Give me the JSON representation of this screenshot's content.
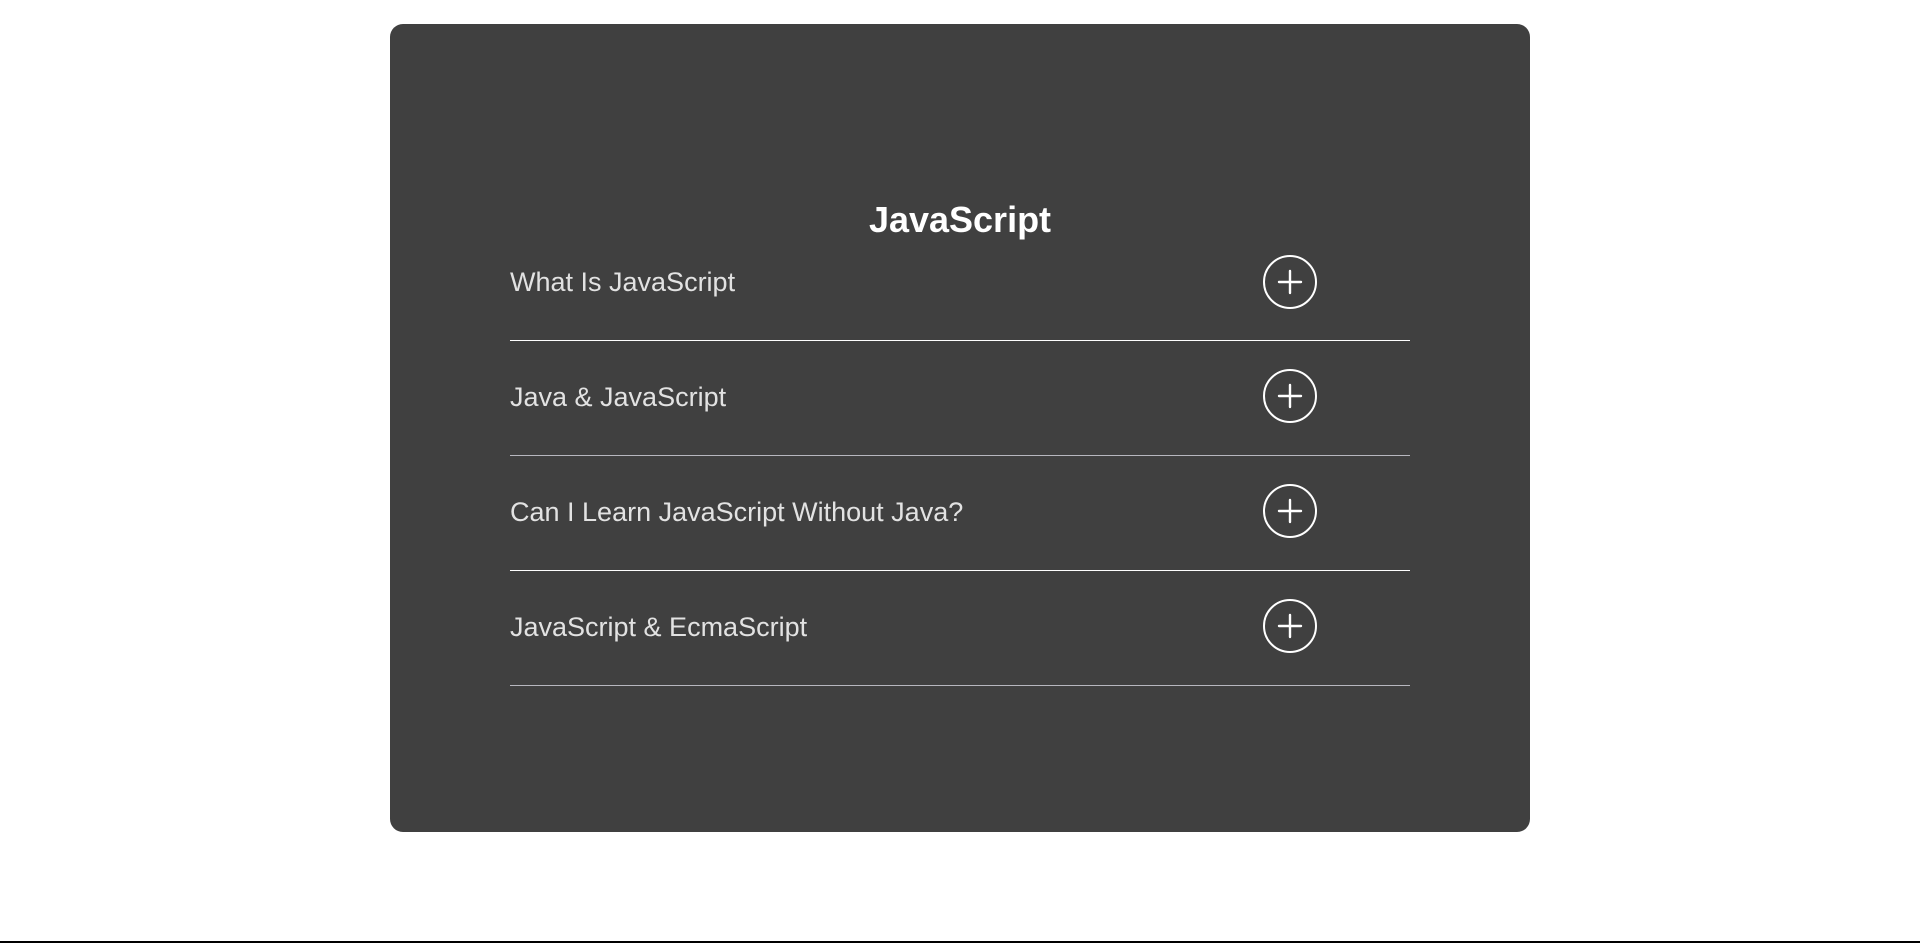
{
  "card": {
    "title": "JavaScript",
    "background": "#404040"
  },
  "faq": {
    "items": [
      {
        "question": "What Is JavaScript",
        "toggle_icon": "plus-circle-icon"
      },
      {
        "question": "Java & JavaScript",
        "toggle_icon": "plus-circle-icon"
      },
      {
        "question": "Can I Learn JavaScript Without Java?",
        "toggle_icon": "plus-circle-icon"
      },
      {
        "question": "JavaScript & EcmaScript",
        "toggle_icon": "plus-circle-icon"
      }
    ]
  },
  "colors": {
    "title": "#ffffff",
    "question_text": "#e2e2e2",
    "divider": "#ffffff",
    "divider_alt": "#b7b7bf"
  }
}
